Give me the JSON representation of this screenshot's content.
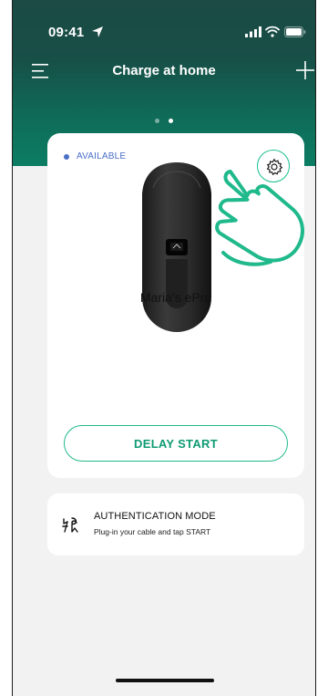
{
  "status_bar": {
    "time": "09:41"
  },
  "header": {
    "title": "Charge at home"
  },
  "pager": {
    "count": 2,
    "active_index": 1
  },
  "charger_card": {
    "status": "AVAILABLE",
    "status_color": "#4a6fc7",
    "device_name": "Maria’s ePro",
    "delay_button": "DELAY START"
  },
  "auth_card": {
    "title": "AUTHENTICATION MODE",
    "subtitle": "Plug-in your cable and tap START"
  },
  "colors": {
    "accent": "#1fb98b",
    "header_dark": "#174f47",
    "header_light": "#0c7d63"
  }
}
